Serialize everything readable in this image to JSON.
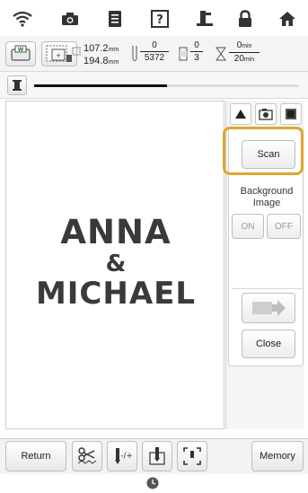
{
  "topbar": {
    "icons": [
      "wifi-icon",
      "camera-icon",
      "document-icon",
      "help-icon",
      "sewing-guide-icon",
      "lock-icon",
      "home-icon"
    ]
  },
  "info": {
    "width_value": "107.2",
    "height_value": "194.8",
    "size_unit": "mm",
    "stitch_current": "0",
    "stitch_total": "5372",
    "color_current": "0",
    "color_total": "3",
    "time_current": "0",
    "time_total": "20",
    "time_unit": "min"
  },
  "progress": {
    "value": 0.5
  },
  "embroidery": {
    "line1": "ANNA",
    "line2": "&",
    "line3": "MICHAEL"
  },
  "panel": {
    "scan_label": "Scan",
    "background_label_line1": "Background",
    "background_label_line2": "Image",
    "on_label": "ON",
    "off_label": "OFF",
    "close_label": "Close"
  },
  "bottombar": {
    "return_label": "Return",
    "memory_label": "Memory"
  },
  "colors": {
    "highlight": "#e0a72a",
    "embroidery_text": "#3a3a3a"
  }
}
